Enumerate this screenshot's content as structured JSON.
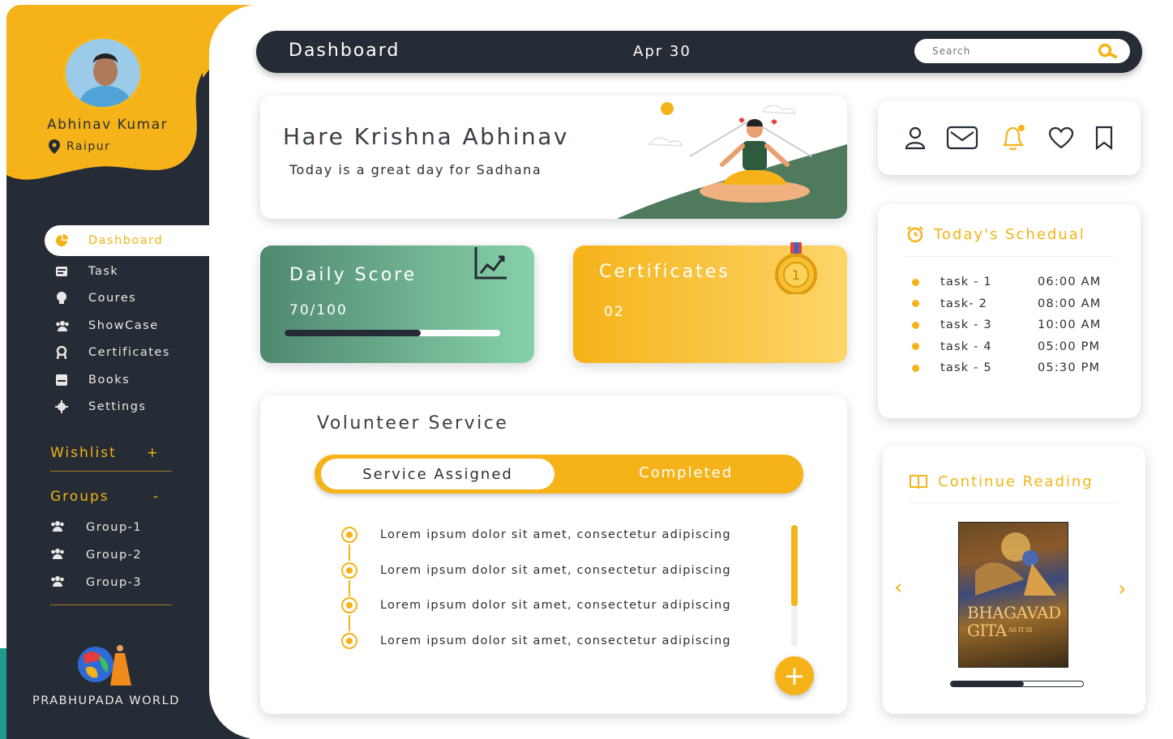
{
  "header": {
    "title": "Dashboard",
    "date": "Apr 30",
    "search_placeholder": "Search"
  },
  "user": {
    "name": "Abhinav Kumar",
    "location": "Raipur"
  },
  "sidebar": {
    "items": [
      {
        "label": "Dashboard",
        "icon": "pie-chart-icon",
        "active": true
      },
      {
        "label": "Task",
        "icon": "task-icon"
      },
      {
        "label": "Coures",
        "icon": "courses-icon"
      },
      {
        "label": "ShowCase",
        "icon": "showcase-icon"
      },
      {
        "label": "Certificates",
        "icon": "certificate-icon"
      },
      {
        "label": "Books",
        "icon": "book-icon"
      },
      {
        "label": "Settings",
        "icon": "gear-icon"
      }
    ],
    "wishlist": {
      "label": "Wishlist",
      "action": "+"
    },
    "groups": {
      "label": "Groups",
      "action": "-",
      "items": [
        "Group-1",
        "Group-2",
        "Group-3"
      ]
    },
    "logo_text": "PRABHUPADA WORLD"
  },
  "greeting": {
    "title": "Hare Krishna Abhinav",
    "subtitle": "Today is a great day for Sadhana"
  },
  "score": {
    "title": "Daily Score",
    "value": "70/100",
    "progress": 0.63
  },
  "certificates": {
    "title": "Certificates",
    "count": "02",
    "medal_text": "1"
  },
  "volunteer": {
    "title": "Volunteer Service",
    "tabs": [
      "Service Assigned",
      "Completed"
    ],
    "items": [
      "Lorem ipsum dolor sit amet, consectetur adipiscing",
      "Lorem ipsum dolor sit amet, consectetur adipiscing",
      "Lorem ipsum dolor sit amet, consectetur adipiscing",
      "Lorem ipsum dolor sit amet, consectetur adipiscing"
    ],
    "add_label": "+"
  },
  "schedule": {
    "title": "Today's Schedual",
    "rows": [
      {
        "task": "task - 1",
        "time": "06:00 AM"
      },
      {
        "task": "task- 2",
        "time": "08:00 AM"
      },
      {
        "task": "task - 3",
        "time": "10:00 AM"
      },
      {
        "task": "task - 4",
        "time": "05:00 PM"
      },
      {
        "task": "task - 5",
        "time": "05:30 PM"
      }
    ]
  },
  "reading": {
    "title": "Continue Reading",
    "book_title_line1": "BHAGAVAD",
    "book_title_line2": "GITA",
    "book_subtitle": "AS IT IS",
    "progress": 0.55
  },
  "colors": {
    "accent": "#f6b319",
    "dark": "#252c35",
    "green": "#4f8870"
  }
}
